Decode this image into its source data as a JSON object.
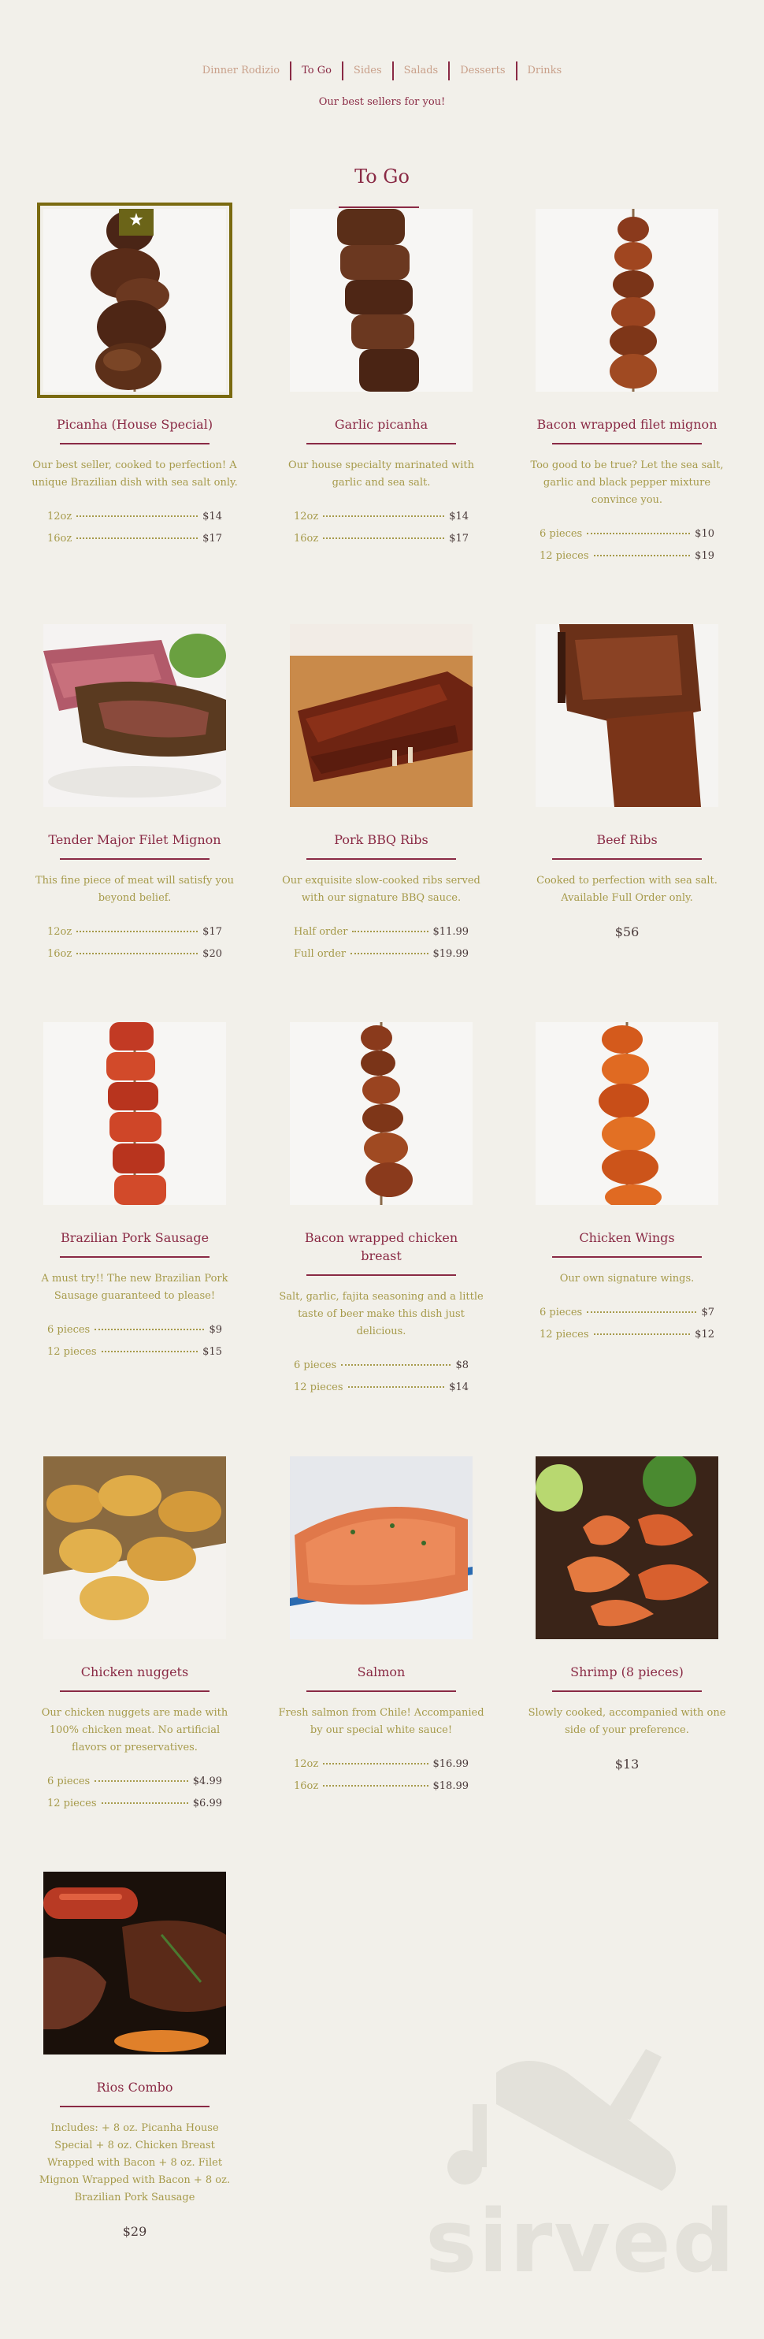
{
  "nav": {
    "tabs": [
      {
        "label": "Dinner Rodizio",
        "active": false
      },
      {
        "label": "To Go",
        "active": true
      },
      {
        "label": "Sides",
        "active": false
      },
      {
        "label": "Salads",
        "active": false
      },
      {
        "label": "Desserts",
        "active": false
      },
      {
        "label": "Drinks",
        "active": false
      }
    ],
    "tagline": "Our best sellers for you!"
  },
  "section": {
    "title": "To Go"
  },
  "colors": {
    "accent": "#8a2a45",
    "description": "#a69a4a",
    "background": "#f2f0ea",
    "badge": "#6b6418"
  },
  "items": [
    {
      "name": "Picanha (House Special)",
      "featured": true,
      "icon": "star-icon",
      "description": "Our best seller, cooked to perfection! A unique Brazilian dish with sea salt only.",
      "prices": [
        {
          "size": "12oz",
          "price": "$14"
        },
        {
          "size": "16oz",
          "price": "$17"
        }
      ]
    },
    {
      "name": "Garlic picanha",
      "description": "Our house specialty marinated with garlic and sea salt.",
      "prices": [
        {
          "size": "12oz",
          "price": "$14"
        },
        {
          "size": "16oz",
          "price": "$17"
        }
      ]
    },
    {
      "name": "Bacon wrapped filet mignon",
      "description": "Too good to be true? Let the sea salt, garlic and black pepper mixture convince you.",
      "prices": [
        {
          "size": "6 pieces",
          "price": "$10"
        },
        {
          "size": "12 pieces",
          "price": "$19"
        }
      ]
    },
    {
      "name": "Tender Major Filet Mignon",
      "description": "This fine piece of meat will satisfy you beyond belief.",
      "prices": [
        {
          "size": "12oz",
          "price": "$17"
        },
        {
          "size": "16oz",
          "price": "$20"
        }
      ]
    },
    {
      "name": "Pork BBQ Ribs",
      "description": "Our exquisite slow-cooked ribs served with our signature BBQ sauce.",
      "prices": [
        {
          "size": "Half order",
          "price": "$11.99"
        },
        {
          "size": "Full order",
          "price": "$19.99"
        }
      ]
    },
    {
      "name": "Beef Ribs",
      "description": "Cooked to perfection with sea salt. Available Full Order only.",
      "single_price": "$56"
    },
    {
      "name": "Brazilian Pork Sausage",
      "description": "A must try!! The new Brazilian Pork Sausage guaranteed to please!",
      "prices": [
        {
          "size": "6 pieces",
          "price": "$9"
        },
        {
          "size": "12 pieces",
          "price": "$15"
        }
      ]
    },
    {
      "name": "Bacon wrapped chicken breast",
      "description": "Salt, garlic, fajita seasoning and a little taste of beer make this dish just delicious.",
      "prices": [
        {
          "size": "6 pieces",
          "price": "$8"
        },
        {
          "size": "12 pieces",
          "price": "$14"
        }
      ]
    },
    {
      "name": "Chicken Wings",
      "description": "Our own signature wings.",
      "prices": [
        {
          "size": "6 pieces",
          "price": "$7"
        },
        {
          "size": "12 pieces",
          "price": "$12"
        }
      ]
    },
    {
      "name": "Chicken nuggets",
      "description": "Our chicken nuggets are made with 100% chicken meat. No artificial flavors or preservatives.",
      "prices": [
        {
          "size": "6 pieces",
          "price": "$4.99"
        },
        {
          "size": "12 pieces",
          "price": "$6.99"
        }
      ]
    },
    {
      "name": "Salmon",
      "description": "Fresh salmon from Chile! Accompanied by our special white sauce!",
      "prices": [
        {
          "size": "12oz",
          "price": "$16.99"
        },
        {
          "size": "16oz",
          "price": "$18.99"
        }
      ]
    },
    {
      "name": "Shrimp (8 pieces)",
      "description": "Slowly cooked, accompanied with one side of your preference.",
      "single_price": "$13"
    },
    {
      "name": "Rios Combo",
      "description": "Includes: + 8 oz. Picanha House Special + 8 oz. Chicken Breast Wrapped with Bacon + 8 oz. Filet Mignon Wrapped with Bacon + 8 oz. Brazilian Pork Sausage",
      "single_price": "$29"
    }
  ],
  "watermark": {
    "text": "sirved",
    "icon": "knife-fork-spoon-icon"
  }
}
